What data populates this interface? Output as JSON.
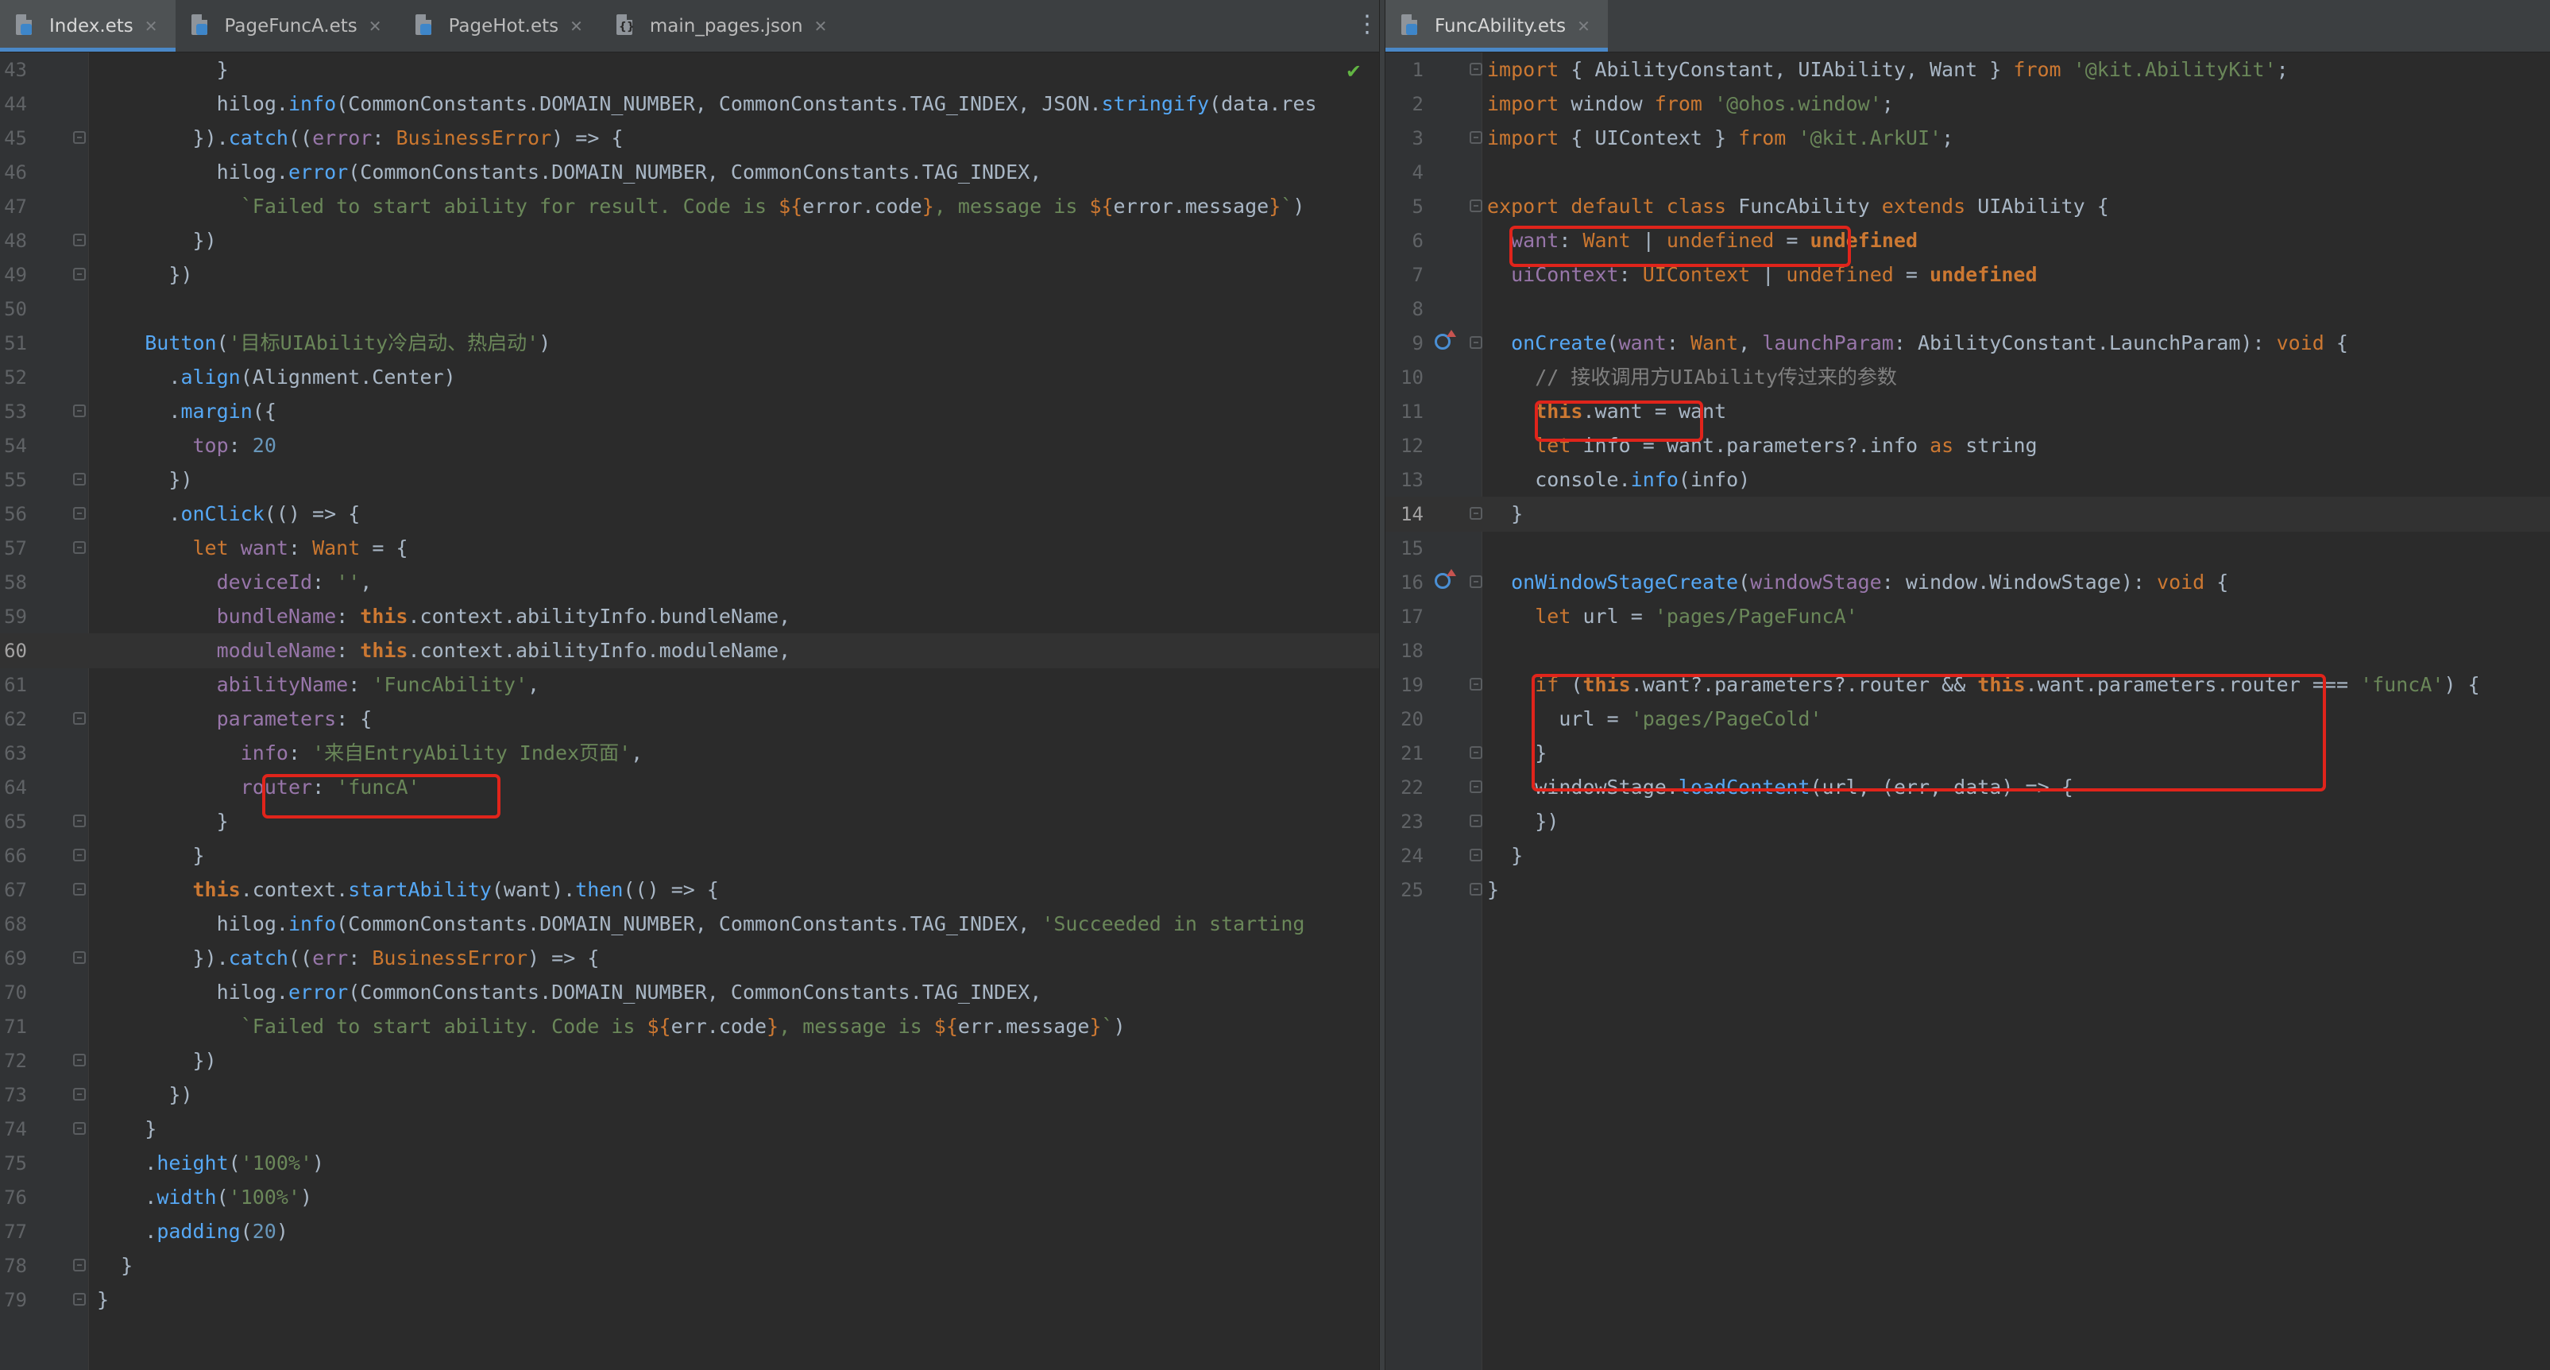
{
  "left_editor": {
    "tabs": [
      {
        "label": "Index.ets",
        "active": true
      },
      {
        "label": "PageFuncA.ets",
        "active": false
      },
      {
        "label": "PageHot.ets",
        "active": false
      },
      {
        "label": "main_pages.json",
        "active": false
      }
    ],
    "current_line": "60",
    "lines": [
      {
        "num": "43",
        "text": "          }"
      },
      {
        "num": "44",
        "text": "          hilog.info(CommonConstants.DOMAIN_NUMBER, CommonConstants.TAG_INDEX, JSON.stringify(data.res"
      },
      {
        "num": "45",
        "text": "        }).catch((error: BusinessError) => {"
      },
      {
        "num": "46",
        "text": "          hilog.error(CommonConstants.DOMAIN_NUMBER, CommonConstants.TAG_INDEX,"
      },
      {
        "num": "47",
        "text": "            `Failed to start ability for result. Code is ${error.code}, message is ${error.message}`)"
      },
      {
        "num": "48",
        "text": "        })"
      },
      {
        "num": "49",
        "text": "      })"
      },
      {
        "num": "50",
        "text": ""
      },
      {
        "num": "51",
        "text": "    Button('目标UIAbility冷启动、热启动')"
      },
      {
        "num": "52",
        "text": "      .align(Alignment.Center)"
      },
      {
        "num": "53",
        "text": "      .margin({"
      },
      {
        "num": "54",
        "text": "        top: 20"
      },
      {
        "num": "55",
        "text": "      })"
      },
      {
        "num": "56",
        "text": "      .onClick(() => {"
      },
      {
        "num": "57",
        "text": "        let want: Want = {"
      },
      {
        "num": "58",
        "text": "          deviceId: '',"
      },
      {
        "num": "59",
        "text": "          bundleName: this.context.abilityInfo.bundleName,"
      },
      {
        "num": "60",
        "text": "          moduleName: this.context.abilityInfo.moduleName,"
      },
      {
        "num": "61",
        "text": "          abilityName: 'FuncAbility',"
      },
      {
        "num": "62",
        "text": "          parameters: {"
      },
      {
        "num": "63",
        "text": "            info: '来自EntryAbility Index页面',"
      },
      {
        "num": "64",
        "text": "            router: 'funcA'"
      },
      {
        "num": "65",
        "text": "          }"
      },
      {
        "num": "66",
        "text": "        }"
      },
      {
        "num": "67",
        "text": "        this.context.startAbility(want).then(() => {"
      },
      {
        "num": "68",
        "text": "          hilog.info(CommonConstants.DOMAIN_NUMBER, CommonConstants.TAG_INDEX, 'Succeeded in starting"
      },
      {
        "num": "69",
        "text": "        }).catch((err: BusinessError) => {"
      },
      {
        "num": "70",
        "text": "          hilog.error(CommonConstants.DOMAIN_NUMBER, CommonConstants.TAG_INDEX,"
      },
      {
        "num": "71",
        "text": "            `Failed to start ability. Code is ${err.code}, message is ${err.message}`)"
      },
      {
        "num": "72",
        "text": "        })"
      },
      {
        "num": "73",
        "text": "      })"
      },
      {
        "num": "74",
        "text": "    }"
      },
      {
        "num": "75",
        "text": "    .height('100%')"
      },
      {
        "num": "76",
        "text": "    .width('100%')"
      },
      {
        "num": "77",
        "text": "    .padding(20)"
      },
      {
        "num": "78",
        "text": "  }"
      },
      {
        "num": "79",
        "text": "}"
      }
    ]
  },
  "right_editor": {
    "tabs": [
      {
        "label": "FuncAbility.ets",
        "active": true
      }
    ],
    "current_line": "14",
    "lines": [
      {
        "num": "1",
        "text": "import { AbilityConstant, UIAbility, Want } from '@kit.AbilityKit';"
      },
      {
        "num": "2",
        "text": "import window from '@ohos.window';"
      },
      {
        "num": "3",
        "text": "import { UIContext } from '@kit.ArkUI';"
      },
      {
        "num": "4",
        "text": ""
      },
      {
        "num": "5",
        "text": "export default class FuncAbility extends UIAbility {"
      },
      {
        "num": "6",
        "text": "  want: Want | undefined = undefined"
      },
      {
        "num": "7",
        "text": "  uiContext: UIContext | undefined = undefined"
      },
      {
        "num": "8",
        "text": ""
      },
      {
        "num": "9",
        "text": "  onCreate(want: Want, launchParam: AbilityConstant.LaunchParam): void {"
      },
      {
        "num": "10",
        "text": "    // 接收调用方UIAbility传过来的参数"
      },
      {
        "num": "11",
        "text": "    this.want = want"
      },
      {
        "num": "12",
        "text": "    let info = want.parameters?.info as string"
      },
      {
        "num": "13",
        "text": "    console.info(info)"
      },
      {
        "num": "14",
        "text": "  }"
      },
      {
        "num": "15",
        "text": ""
      },
      {
        "num": "16",
        "text": "  onWindowStageCreate(windowStage: window.WindowStage): void {"
      },
      {
        "num": "17",
        "text": "    let url = 'pages/PageFuncA'"
      },
      {
        "num": "18",
        "text": ""
      },
      {
        "num": "19",
        "text": "    if (this.want?.parameters?.router && this.want.parameters.router === 'funcA') {"
      },
      {
        "num": "20",
        "text": "      url = 'pages/PageCold'"
      },
      {
        "num": "21",
        "text": "    }"
      },
      {
        "num": "22",
        "text": "    windowStage.loadContent(url, (err, data) => {"
      },
      {
        "num": "23",
        "text": "    })"
      },
      {
        "num": "24",
        "text": "  }"
      },
      {
        "num": "25",
        "text": "}"
      }
    ]
  },
  "icons": {
    "more": "more-vertical-icon",
    "inspection": "check-icon",
    "override": "override-method-icon"
  },
  "colors": {
    "highlight_box": "#e0241b",
    "editor_bg": "#2b2b2b",
    "tab_active_underline": "#4a88c7"
  }
}
